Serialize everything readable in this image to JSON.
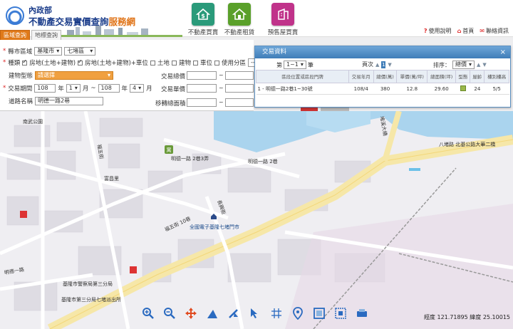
{
  "header": {
    "ministry": "內政部",
    "service_main": "不動產交易實價查詢",
    "service_accent": "服務網",
    "nav": [
      {
        "label": "不動產買賣",
        "color": "#2a9a7a"
      },
      {
        "label": "不動產租賃",
        "color": "#5aa02a"
      },
      {
        "label": "預售屋買賣",
        "color": "#c0338a"
      }
    ],
    "links": {
      "help": "使用說明",
      "home": "首頁",
      "contact": "聯絡資訊"
    },
    "tabs": {
      "area": "區域查詢",
      "landmark": "地標查詢"
    }
  },
  "search": {
    "county_label": "縣市區域",
    "county_value": "基隆市",
    "district_value": "七堵區",
    "type_label": "種類",
    "type_options": [
      {
        "label": "房地(土地+建物)",
        "checked": true
      },
      {
        "label": "房地(土地+建物)+車位",
        "checked": true
      },
      {
        "label": "土地",
        "checked": false
      },
      {
        "label": "建物",
        "checked": false
      },
      {
        "label": "車位",
        "checked": false
      },
      {
        "label": "使用分區",
        "checked": false
      }
    ],
    "zone_value": "-----",
    "building_type_label": "建物型態",
    "building_type_value": "請選擇",
    "period_label": "交易期間",
    "from_year": "108",
    "from_month": "1",
    "to_year": "108",
    "to_month": "4",
    "year_unit": "年",
    "month_unit": "月",
    "tilde": "~",
    "road_label": "道路名稱",
    "road_value": "明德一路2巷",
    "total_price_label": "交易總價",
    "unit_price_label": "交易單價",
    "area_label": "移轉總面積"
  },
  "results": {
    "title": "交易資料",
    "close": "×",
    "page_prefix": "第",
    "page_value": "1~1",
    "page_suffix": "筆",
    "page_label": "頁次",
    "page_number": "1",
    "sort_label": "排序：",
    "sort_value": "總價",
    "columns": [
      "區段位置或區段門牌",
      "交易年月",
      "總價(萬)",
      "單價(萬/坪)",
      "總面積(坪)",
      "型態",
      "屋齡",
      "樓別樓高"
    ],
    "rows": [
      {
        "addr": "1 - 明德一路2巷1~30號",
        "date": "108/4",
        "total": "380",
        "unit": "12.8",
        "area": "29.60",
        "age": "24",
        "floor": "5/5"
      }
    ]
  },
  "map": {
    "labels": {
      "n1": "南武公園",
      "n2": "明德一路 2巷3弄",
      "n3": "明德一路 2巷",
      "n4": "富昌里",
      "n5": "福五街",
      "n6": "福五街 10巷",
      "n7": "全國電子基隆七堵門市",
      "n8": "明德一路",
      "n9": "基隆市警察局第三分局",
      "n10": "基隆市第三分局七堵派出所",
      "n11": "八堵路 北基公路大華二橋",
      "n12": "堵溪大橋",
      "n13": "長興街",
      "n14": "寓"
    },
    "coords": "經度 121.71895  緯度  25.10015"
  }
}
